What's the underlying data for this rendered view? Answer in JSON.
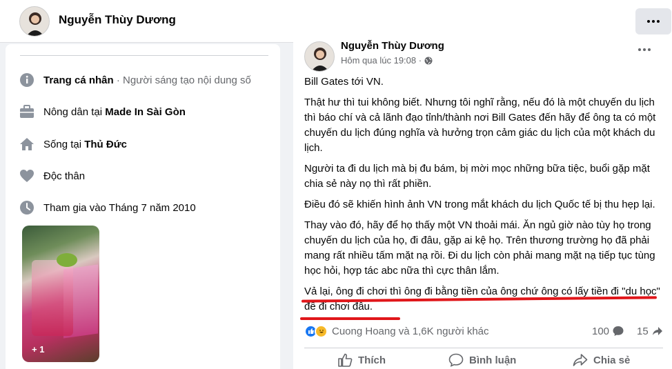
{
  "header": {
    "profile_name": "Nguyễn Thùy Dương"
  },
  "intro": {
    "cut_top_text": "...",
    "rows": [
      {
        "icon": "info-icon",
        "bold": "Trang cá nhân",
        "rest": " · Người sáng tạo nội dung số"
      },
      {
        "icon": "briefcase-icon",
        "prefix": "Nông dân tại ",
        "bold": "Made In Sài Gòn"
      },
      {
        "icon": "home-icon",
        "prefix": "Sống tại ",
        "bold": "Thủ Đức"
      },
      {
        "icon": "heart-icon",
        "prefix": "Độc thân"
      },
      {
        "icon": "clock-icon",
        "prefix": "Tham gia vào Tháng 7 năm 2010"
      }
    ],
    "photo_more": "+ 1"
  },
  "post": {
    "author": "Nguyễn Thùy Dương",
    "time": "Hôm qua lúc 19:08 ·",
    "privacy_icon": "globe-icon",
    "paragraphs": [
      "Bill Gates tới VN.",
      "Thật hư thì tui không biết. Nhưng tôi nghĩ rằng, nếu đó là một chuyến du lịch thì báo chí và cả lãnh đạo tỉnh/thành nơi Bill Gates đến hãy để ông ta có một chuyến du lịch đúng nghĩa và hưởng trọn cảm giác du lịch của một khách du lịch.",
      "Người ta đi du lịch mà bị đu bám, bị mời mọc những bữa tiệc, buổi gặp mặt chia sẻ này nọ thì rất phiền.",
      "Điều đó sẽ khiến hình ảnh VN trong mắt khách du lịch Quốc tế bị thu hẹp lại.",
      "Thay vào đó, hãy để họ thấy một VN thoải mái. Ăn ngủ giờ nào tùy họ trong chuyến du lịch của họ, đi đâu, gặp ai kệ họ. Trên thương trường họ đã phải mang rất nhiều tấm mặt nạ rồi. Đi du lịch còn phải mang mặt nạ tiếp tục tùng học hỏi, hợp tác abc nữa thì cực thân lắm.",
      "Vả lại, ông đi chơi thì ông đi bằng tiền của ông chứ ông có lấy tiền đi \"du học\" để đi chơi đâu."
    ],
    "reactions_text": "Cuong Hoang và 1,6K người khác",
    "comment_count": "100",
    "share_count": "15",
    "actions": {
      "like": "Thích",
      "comment": "Bình luận",
      "share": "Chia sẻ"
    },
    "annotation_color": "#e0161a"
  },
  "colors": {
    "accent": "#1877f2",
    "muted": "#65676b",
    "background": "#f0f2f5"
  }
}
